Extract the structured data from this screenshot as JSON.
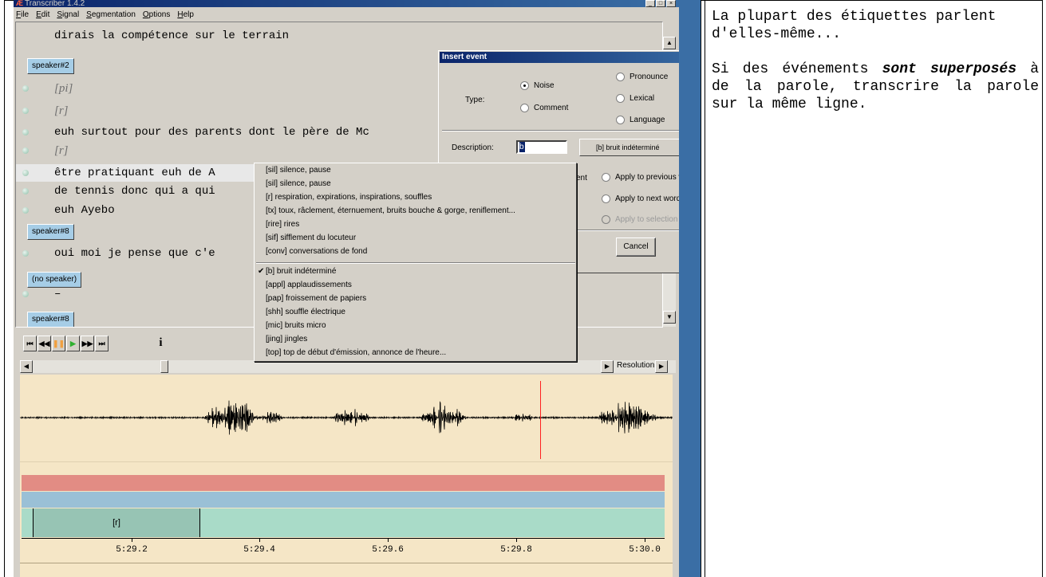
{
  "app": {
    "title": "Transcriber 1.4.2",
    "menu": [
      "File",
      "Edit",
      "Signal",
      "Segmentation",
      "Options",
      "Help"
    ]
  },
  "transcript": {
    "lines": [
      {
        "kind": "text",
        "text": "dirais la compétence sur le terrain"
      },
      {
        "kind": "speaker",
        "text": "speaker#2"
      },
      {
        "kind": "event",
        "text": "[pi]"
      },
      {
        "kind": "event",
        "text": "[r]"
      },
      {
        "kind": "text",
        "text": "euh surtout pour des parents dont le père de Mc"
      },
      {
        "kind": "event",
        "text": "[r]"
      },
      {
        "kind": "text",
        "text": "être pratiquant euh de A"
      },
      {
        "kind": "text",
        "text": "de tennis donc qui a qui"
      },
      {
        "kind": "text",
        "text": "euh Ayebo"
      },
      {
        "kind": "speaker",
        "text": "speaker#8"
      },
      {
        "kind": "text",
        "text": "oui moi je pense que c'e"
      },
      {
        "kind": "speaker",
        "text": "(no speaker)"
      },
      {
        "kind": "text",
        "text": "–"
      },
      {
        "kind": "speaker",
        "text": "speaker#8"
      }
    ]
  },
  "dialog": {
    "title": "Insert event",
    "close": "×",
    "type_label": "Type:",
    "type_options": [
      "Noise",
      "Comment",
      "Pronounce",
      "Lexical",
      "Language"
    ],
    "selected_type": "Noise",
    "description_label": "Description:",
    "description_value": "b",
    "description_menu_value": "[b] bruit indéterminé",
    "extent_partial": "ent",
    "apply_options": [
      "Apply to previous word",
      "Apply to next word",
      "Apply to selection"
    ],
    "cancel_label": "Cancel"
  },
  "dropdown": {
    "group1": [
      "[sil] silence, pause",
      "[sil] silence, pause",
      "[r] respiration, expirations, inspirations, souffles",
      "[tx] toux, râclement, éternuement, bruits bouche & gorge, reniflement...",
      "[rire] rires",
      "[sif] sifflement du locuteur",
      "[conv] conversations de fond"
    ],
    "group2": [
      "[b] bruit indéterminé",
      "[appl] applaudissements",
      "[pap] froissement de papiers",
      "[shh] souffle électrique",
      "[mic] bruits micro",
      "[jing] jingles",
      "[top] top de début d'émission, annonce de l'heure..."
    ],
    "checked": "[b] bruit indéterminé",
    "check_glyph": "✔"
  },
  "player": {
    "buttons": [
      "⏮",
      "◀◀",
      "❚❚",
      "▶",
      "▶▶",
      "⏭"
    ],
    "info_glyph": "i",
    "resolution_label": "Resolution"
  },
  "signal": {
    "segment_label": "[r]",
    "time_labels": [
      "5:29.2",
      "5:29.4",
      "5:29.6",
      "5:29.8",
      "5:30.0"
    ]
  },
  "note": {
    "p1": "La plupart des étiquettes parlent d'elles-même...",
    "p2_before": "Si des événements ",
    "p2_emph": "sont superposés",
    "p2_after": " à de la parole, transcrire la parole sur la même ligne."
  },
  "colors": {
    "speaker_button": "#a6cde6",
    "waveform_bg": "#f5e6c6",
    "segment_red": "#e28c84",
    "segment_blue": "#9ac0d6",
    "segment_green": "#a9dbc8",
    "cursor": "#ff2020"
  }
}
